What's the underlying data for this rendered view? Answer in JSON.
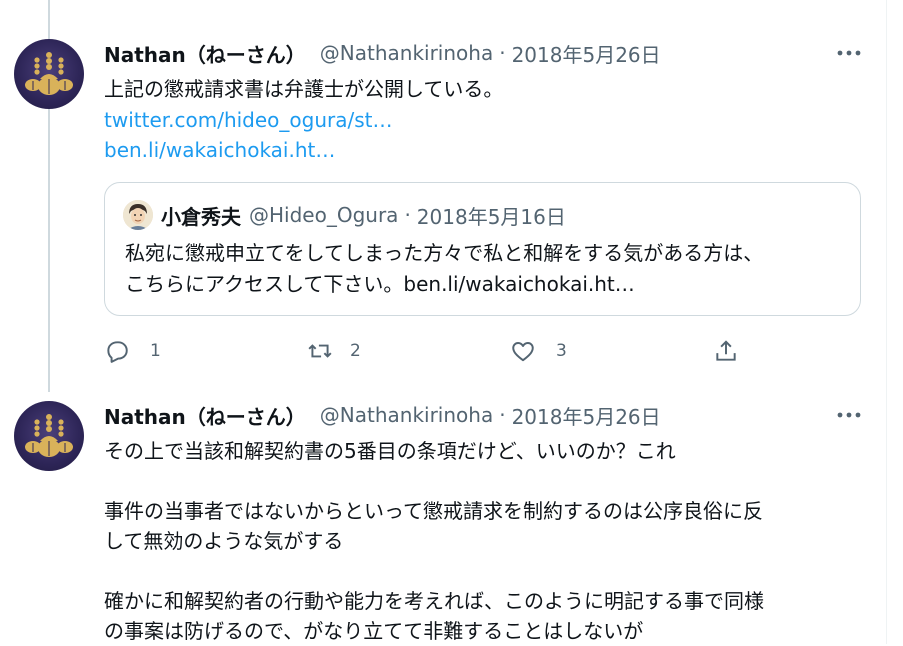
{
  "tweet1": {
    "name": "Nathan（ねーさん）",
    "handle": "@Nathankirinoha",
    "dot": "·",
    "date": "2018年5月26日",
    "text": "上記の懲戒請求書は弁護士が公開している。",
    "link1": "twitter.com/hideo_ogura/st…",
    "link2": "ben.li/wakaichokai.ht…",
    "quote": {
      "name": "小倉秀夫",
      "handle": "@Hideo_Ogura",
      "dot": "·",
      "date": "2018年5月16日",
      "line1": "私宛に懲戒申立てをしてしまった方々で私と和解をする気がある方は、",
      "line2": "こちらにアクセスして下さい。ben.li/wakaichokai.ht…"
    },
    "actions": {
      "reply_count": "1",
      "retweet_count": "2",
      "like_count": "3"
    }
  },
  "tweet2": {
    "name": "Nathan（ねーさん）",
    "handle": "@Nathankirinoha",
    "dot": "·",
    "date": "2018年5月26日",
    "line1": "その上で当該和解契約書の5番目の条項だけど、いいのか？これ",
    "line2": "事件の当事者ではないからといって懲戒請求を制約するのは公序良俗に反",
    "line3": "して無効のような気がする",
    "line4": "確かに和解契約者の行動や能力を考えれば、このように明記する事で同様",
    "line5": "の事案は防げるので、がなり立てて非難することはしないが"
  },
  "icons": {
    "more": "more-horizontal-icon",
    "reply": "reply-bubble-icon",
    "retweet": "retweet-arrows-icon",
    "like": "heart-icon",
    "share": "share-upload-icon"
  },
  "colors": {
    "text": "#0f1419",
    "secondary": "#536471",
    "link": "#1d9bf0",
    "border": "#cfd9de"
  }
}
